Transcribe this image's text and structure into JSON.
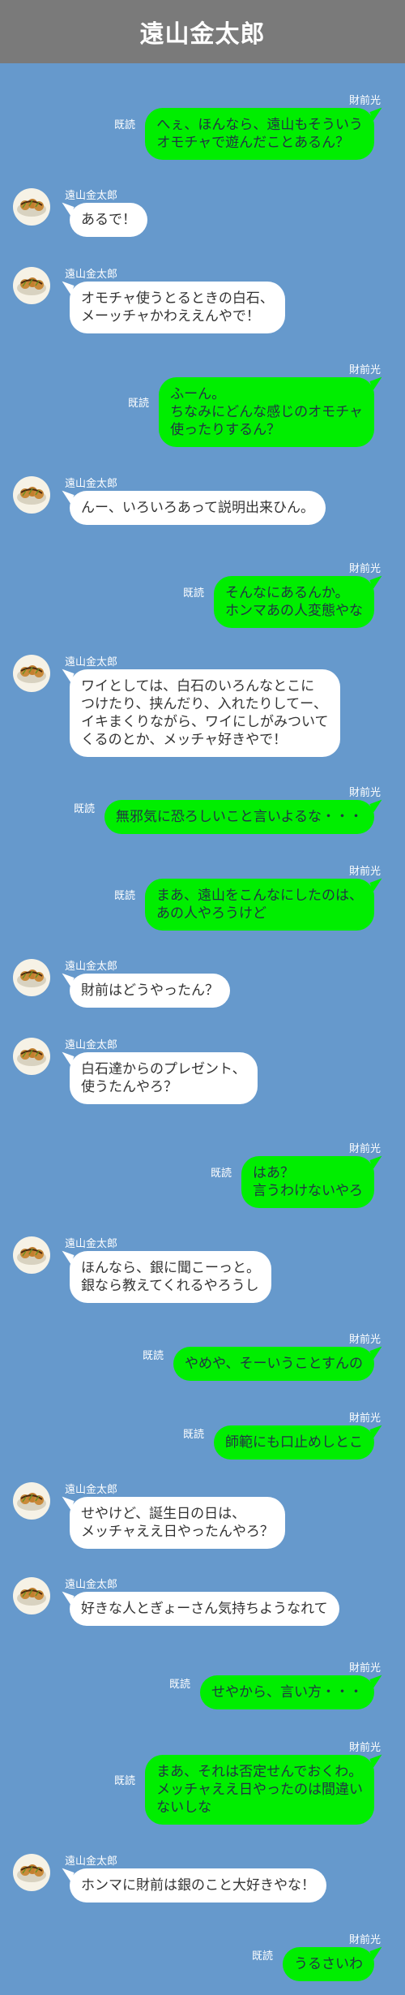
{
  "header": {
    "title": "遠山金太郎"
  },
  "labels": {
    "read": "既読"
  },
  "avatar_icon": "takoyaki-icon",
  "messages": [
    {
      "side": "sent",
      "sender": "財前光",
      "text": "へぇ、ほんなら、遠山もそういう\nオモチャで遊んだことあるん？",
      "read": true
    },
    {
      "side": "recv",
      "sender": "遠山金太郎",
      "text": "あるで！"
    },
    {
      "side": "recv",
      "sender": "遠山金太郎",
      "text": "オモチャ使うとるときの白石、\nメーッチャかわええんやで！"
    },
    {
      "side": "sent",
      "sender": "財前光",
      "text": "ふーん。\nちなみにどんな感じのオモチャ\n使ったりするん？",
      "read": true
    },
    {
      "side": "recv",
      "sender": "遠山金太郎",
      "text": "んー、いろいろあって説明出来ひん。"
    },
    {
      "side": "sent",
      "sender": "財前光",
      "text": "そんなにあるんか。\nホンマあの人変態やな",
      "read": true
    },
    {
      "side": "recv",
      "sender": "遠山金太郎",
      "text": "ワイとしては、白石のいろんなとこに\nつけたり、挟んだり、入れたりしてー、\nイキまくりながら、ワイにしがみついて\nくるのとか、メッチャ好きやで！"
    },
    {
      "side": "sent",
      "sender": "財前光",
      "text": "無邪気に恐ろしいこと言いよるな・・・",
      "read": true
    },
    {
      "side": "sent",
      "sender": "財前光",
      "text": "まあ、遠山をこんなにしたのは、\nあの人やろうけど",
      "read": true
    },
    {
      "side": "recv",
      "sender": "遠山金太郎",
      "text": "財前はどうやったん？"
    },
    {
      "side": "recv",
      "sender": "遠山金太郎",
      "text": "白石達からのプレゼント、\n使うたんやろ？"
    },
    {
      "side": "sent",
      "sender": "財前光",
      "text": "はあ？\n言うわけないやろ",
      "read": true
    },
    {
      "side": "recv",
      "sender": "遠山金太郎",
      "text": "ほんなら、銀に聞こーっと。\n銀なら教えてくれるやろうし"
    },
    {
      "side": "sent",
      "sender": "財前光",
      "text": "やめや、そーいうことすんの",
      "read": true
    },
    {
      "side": "sent",
      "sender": "財前光",
      "text": "師範にも口止めしとこ",
      "read": true
    },
    {
      "side": "recv",
      "sender": "遠山金太郎",
      "text": "せやけど、誕生日の日は、\nメッチャええ日やったんやろ？"
    },
    {
      "side": "recv",
      "sender": "遠山金太郎",
      "text": "好きな人とぎょーさん気持ちようなれて"
    },
    {
      "side": "sent",
      "sender": "財前光",
      "text": "せやから、言い方・・・",
      "read": true
    },
    {
      "side": "sent",
      "sender": "財前光",
      "text": "まあ、それは否定せんでおくわ。\nメッチャええ日やったのは間違い\nないしな",
      "read": true
    },
    {
      "side": "recv",
      "sender": "遠山金太郎",
      "text": "ホンマに財前は銀のこと大好きやな！"
    },
    {
      "side": "sent",
      "sender": "財前光",
      "text": "うるさいわ",
      "read": true
    }
  ]
}
